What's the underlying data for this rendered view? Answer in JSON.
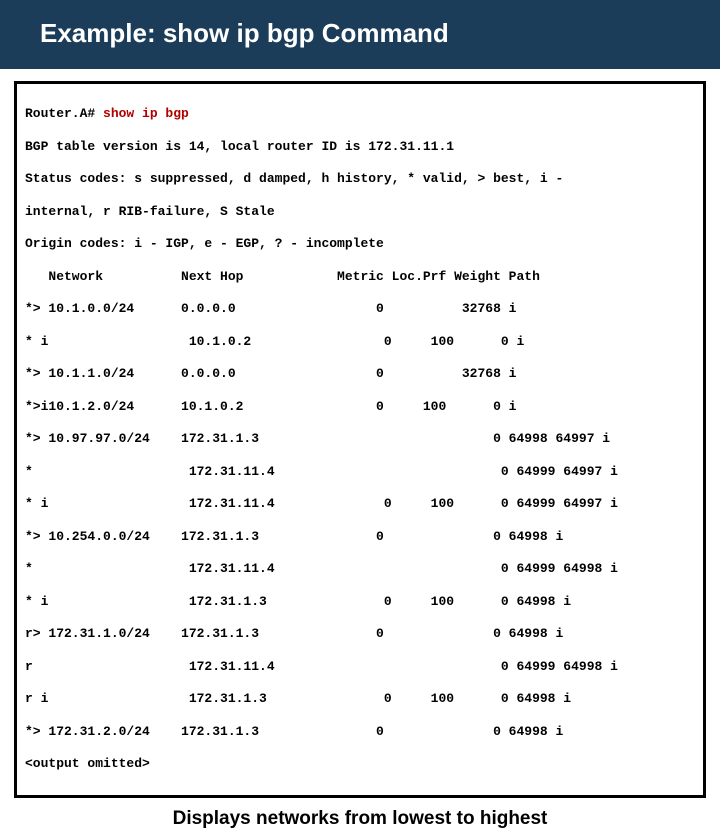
{
  "title": "Example: show ip bgp Command",
  "caption": "Displays networks from lowest to highest",
  "terminal": {
    "prompt": "Router.A# ",
    "command": "show ip bgp",
    "header_lines": [
      "BGP table version is 14, local router ID is 172.31.11.1",
      "Status codes: s suppressed, d damped, h history, * valid, > best, i -",
      "internal, r RIB-failure, S Stale",
      "Origin codes: i - IGP, e - EGP, ? - incomplete"
    ],
    "columns": "   Network          Next Hop            Metric Loc.Prf Weight Path",
    "rows": [
      "*> 10.1.0.0/24      0.0.0.0                  0          32768 i",
      "* i                  10.1.0.2                 0     100      0 i",
      "*> 10.1.1.0/24      0.0.0.0                  0          32768 i",
      "*>i10.1.2.0/24      10.1.0.2                 0     100      0 i",
      "*> 10.97.97.0/24    172.31.1.3                              0 64998 64997 i",
      "*                    172.31.11.4                             0 64999 64997 i",
      "* i                  172.31.11.4              0     100      0 64999 64997 i",
      "*> 10.254.0.0/24    172.31.1.3               0              0 64998 i",
      "*                    172.31.11.4                             0 64999 64998 i",
      "* i                  172.31.1.3               0     100      0 64998 i",
      "r> 172.31.1.0/24    172.31.1.3               0              0 64998 i",
      "r                    172.31.11.4                             0 64999 64998 i",
      "r i                  172.31.1.3               0     100      0 64998 i",
      "*> 172.31.2.0/24    172.31.1.3               0              0 64998 i"
    ],
    "footer": "<output omitted>"
  }
}
